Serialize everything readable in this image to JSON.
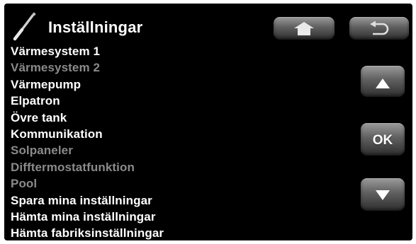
{
  "header": {
    "title": "Inställningar"
  },
  "menu": {
    "items": [
      {
        "label": "Värmesystem 1",
        "enabled": true
      },
      {
        "label": "Värmesystem 2",
        "enabled": false
      },
      {
        "label": "Värmepump",
        "enabled": true
      },
      {
        "label": "Elpatron",
        "enabled": true
      },
      {
        "label": "Övre tank",
        "enabled": true
      },
      {
        "label": "Kommunikation",
        "enabled": true
      },
      {
        "label": "Solpaneler",
        "enabled": false
      },
      {
        "label": "Difftermostatfunktion",
        "enabled": false
      },
      {
        "label": "Pool",
        "enabled": false
      },
      {
        "label": "Spara mina inställningar",
        "enabled": true
      },
      {
        "label": "Hämta mina inställningar",
        "enabled": true
      },
      {
        "label": "Hämta fabriksinställningar",
        "enabled": true
      }
    ]
  },
  "controls": {
    "ok_label": "OK",
    "home_icon": "home-icon",
    "back_icon": "back-arrow-icon",
    "up_icon": "up-arrow-icon",
    "down_icon": "down-arrow-icon"
  },
  "colors": {
    "background": "#000000",
    "text_enabled": "#ffffff",
    "text_disabled": "#8a8a8a",
    "button": "#6a6a6a"
  }
}
